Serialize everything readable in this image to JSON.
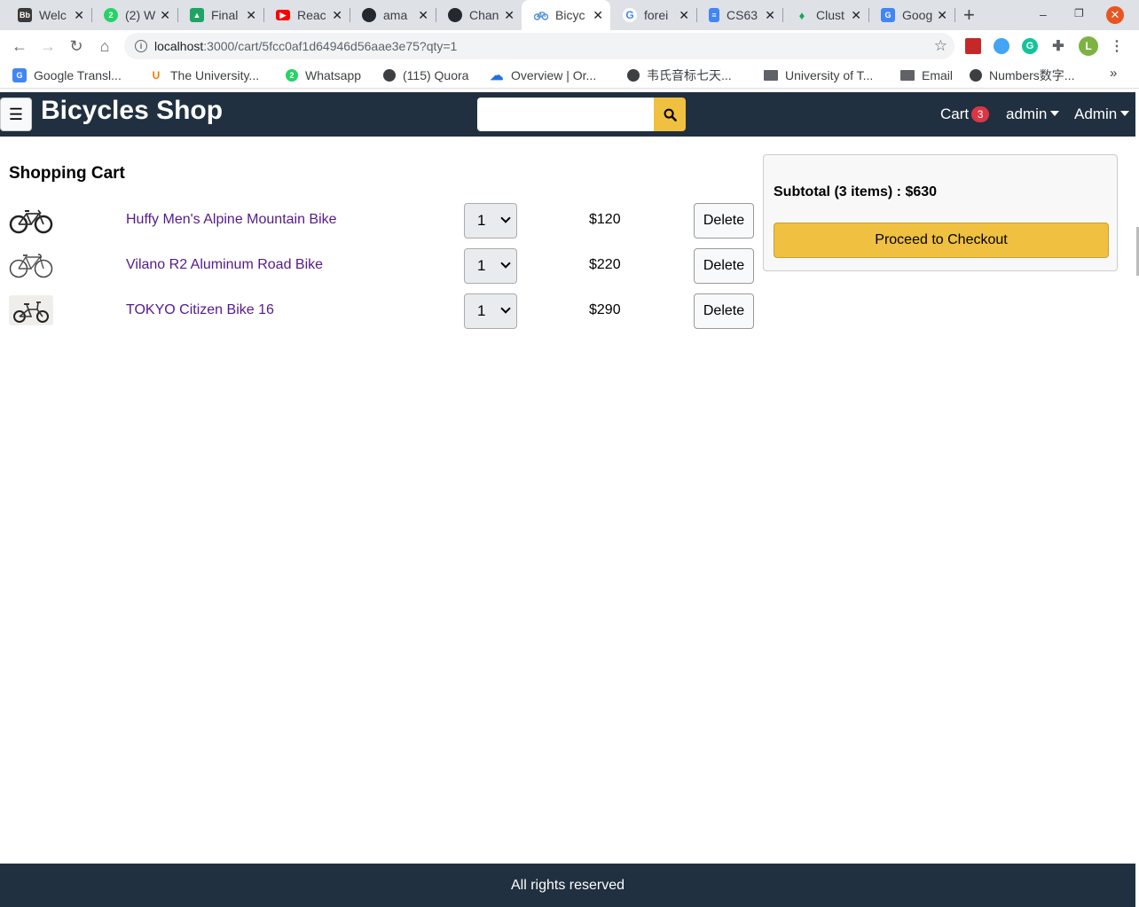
{
  "browser": {
    "tabs": [
      {
        "title": "Welc",
        "icon": "blackboard-icon",
        "color": "#3a3a3a",
        "glyph": "Bb"
      },
      {
        "title": "(2) W",
        "icon": "whatsapp-icon",
        "color": "#25d366",
        "glyph": "2"
      },
      {
        "title": "Final",
        "icon": "google-drive-icon",
        "color": "#1fa463",
        "glyph": "▲"
      },
      {
        "title": "Reac",
        "icon": "youtube-icon",
        "color": "#ff0000",
        "glyph": "▶"
      },
      {
        "title": "ama",
        "icon": "github-icon",
        "color": "#24292e",
        "glyph": "●"
      },
      {
        "title": "Chan",
        "icon": "github-icon",
        "color": "#24292e",
        "glyph": "●"
      },
      {
        "title": "Bicyc",
        "icon": "bicycle-icon",
        "color": "#4a90d9",
        "glyph": "🚲"
      },
      {
        "title": "forei",
        "icon": "google-icon",
        "color": "#4285f4",
        "glyph": "G"
      },
      {
        "title": "CS63",
        "icon": "google-docs-icon",
        "color": "#4285f4",
        "glyph": "≡"
      },
      {
        "title": "Clust",
        "icon": "mongodb-leaf-icon",
        "color": "#13aa52",
        "glyph": "♦"
      },
      {
        "title": "Goog",
        "icon": "google-translate-icon",
        "color": "#4285f4",
        "glyph": "G"
      }
    ],
    "url_host": "localhost",
    "url_path": ":3000/cart/5fcc0af1d64946d56aae3e75?qty=1",
    "bookmarks": [
      {
        "label": "Google Transl...",
        "icon": "google-translate-icon",
        "color": "#4285f4",
        "glyph": "G"
      },
      {
        "label": "The University...",
        "icon": "university-logo-icon",
        "color": "#f57c00",
        "glyph": "U"
      },
      {
        "label": "Whatsapp",
        "icon": "whatsapp-icon",
        "color": "#25d366",
        "glyph": "2"
      },
      {
        "label": "(115) Quora",
        "icon": "globe-icon",
        "color": "#3c4043",
        "glyph": "◍"
      },
      {
        "label": "Overview | Or...",
        "icon": "cloud-icon",
        "color": "#1a73e8",
        "glyph": "☁"
      },
      {
        "label": "韦氏音标七天...",
        "icon": "globe-icon",
        "color": "#3c4043",
        "glyph": "◍"
      },
      {
        "label": "University of T...",
        "icon": "folder-icon",
        "color": "#5f6368",
        "glyph": ""
      },
      {
        "label": "Email",
        "icon": "folder-icon",
        "color": "#5f6368",
        "glyph": ""
      },
      {
        "label": "Numbers数字...",
        "icon": "globe-icon",
        "color": "#3c4043",
        "glyph": "◍"
      }
    ]
  },
  "app": {
    "brand": "Bicycles Shop",
    "search_value": "",
    "cart_label": "Cart",
    "cart_count": "3",
    "user_menu": "admin",
    "admin_menu": "Admin"
  },
  "cart": {
    "heading": "Shopping Cart",
    "items": [
      {
        "name": "Huffy Men's Alpine Mountain Bike",
        "qty": "1",
        "price": "$120",
        "delete_label": "Delete"
      },
      {
        "name": "Vilano R2 Aluminum Road Bike",
        "qty": "1",
        "price": "$220",
        "delete_label": "Delete"
      },
      {
        "name": "TOKYO Citizen Bike 16",
        "qty": "1",
        "price": "$290",
        "delete_label": "Delete"
      }
    ],
    "subtotal": "Subtotal (3 items) : $630",
    "checkout_label": "Proceed to Checkout"
  },
  "footer": {
    "text": "All rights reserved"
  },
  "colors": {
    "navbar": "#203040",
    "accent": "#f0c040",
    "link": "#551a8b",
    "badge": "#dc3545"
  }
}
